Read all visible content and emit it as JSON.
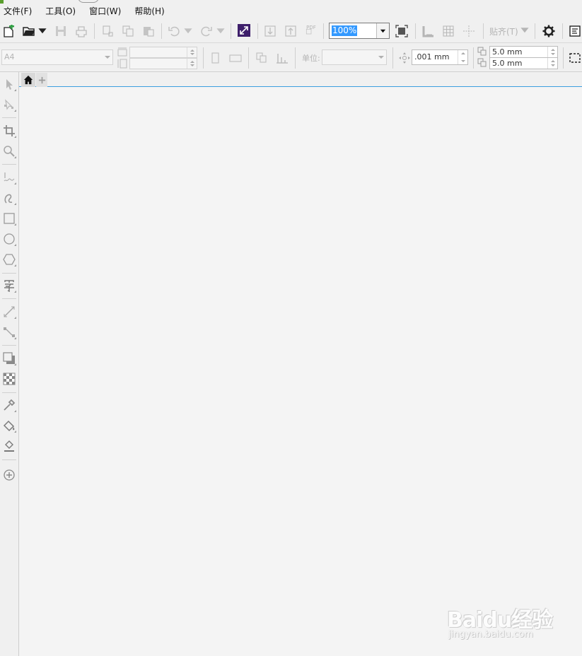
{
  "menu": [
    "文件(F)",
    "工具(O)",
    "窗口(W)",
    "帮助(H)"
  ],
  "toolbar": {
    "zoom_value": "100%",
    "snap_label": "贴齐(T)",
    "pdf_label": "PDF"
  },
  "property_bar": {
    "page_size": "A4",
    "unit_label": "单位:",
    "nudge_value": ".001 mm",
    "duplicate_x": "5.0 mm",
    "duplicate_y": "5.0 mm"
  },
  "watermark": {
    "logo": "Baidu经验",
    "url": "jingyan.baidu.com"
  },
  "colors": {
    "accent": "#3399ff",
    "tab_line": "#3c9fe0",
    "canvas": "#f4f4f4"
  }
}
